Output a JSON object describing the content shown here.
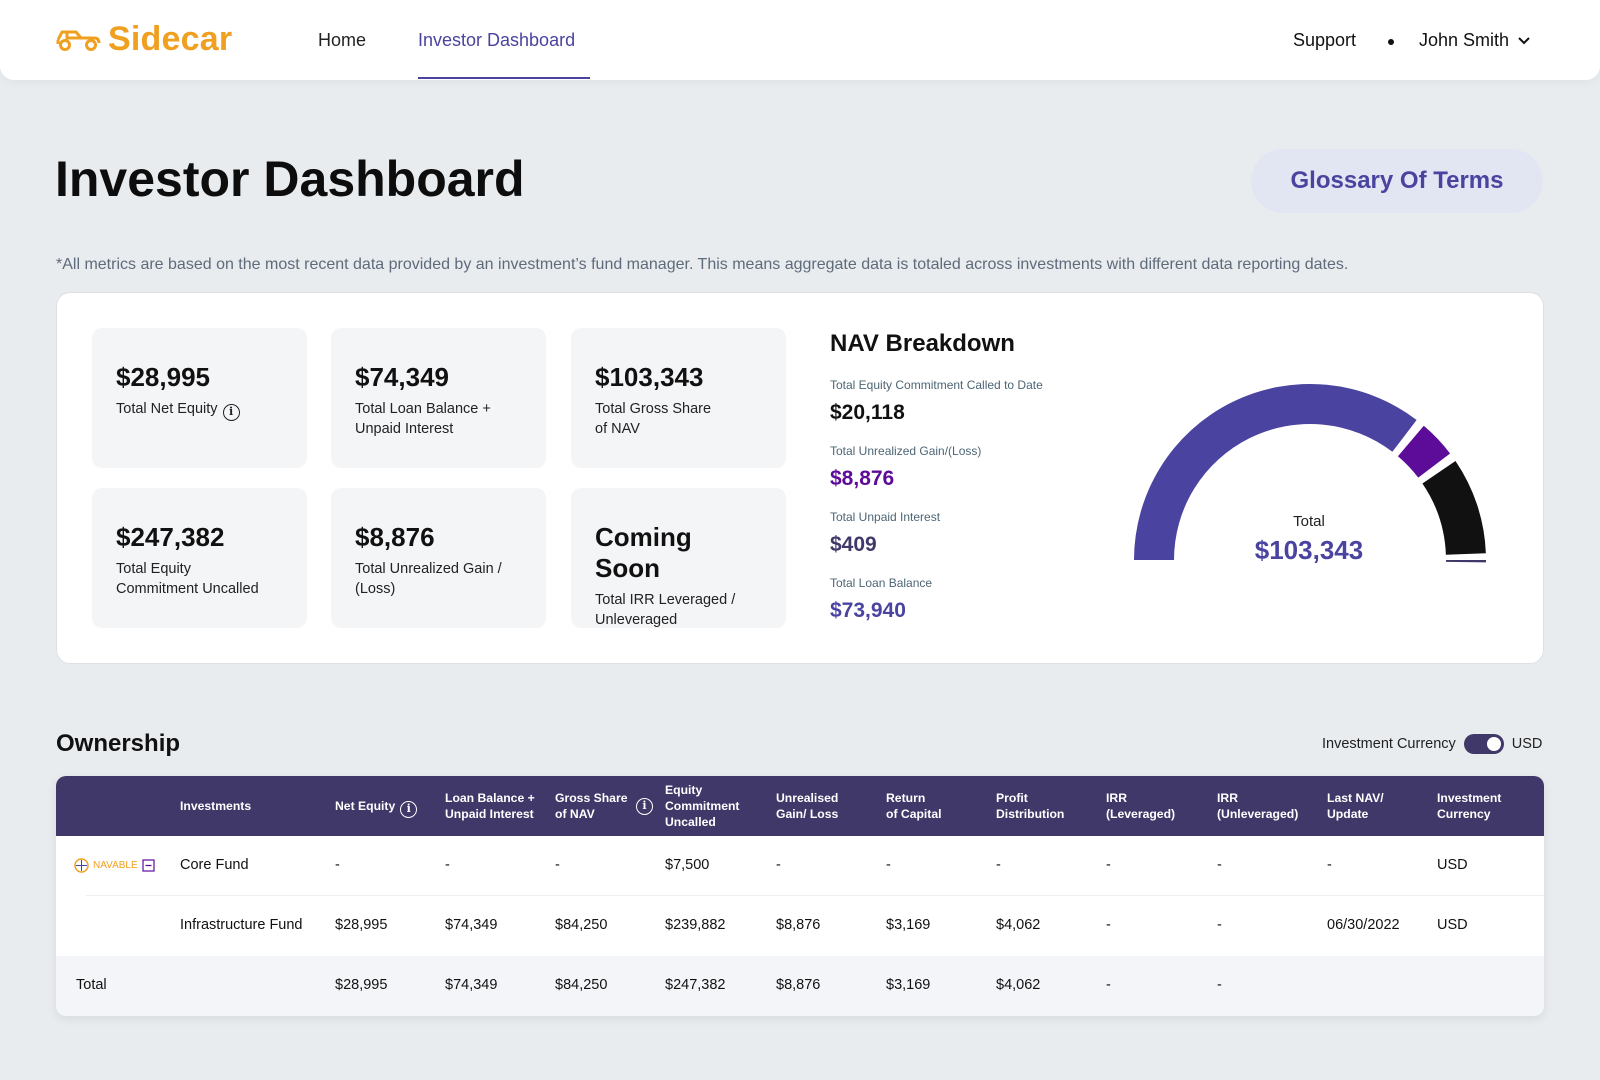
{
  "brand": {
    "name": "Sidecar",
    "icon": "car-icon",
    "color": "#f0a020"
  },
  "nav": {
    "home": "Home",
    "investor_dashboard": "Investor Dashboard",
    "support": "Support",
    "user": "John Smith"
  },
  "page": {
    "title": "Investor Dashboard",
    "glossary_button": "Glossary Of Terms",
    "disclaimer": "*All metrics are based on the most recent data provided by an investment’s fund manager. This means aggregate data is totaled across investments with different data reporting dates."
  },
  "metrics": [
    {
      "value": "$28,995",
      "label": "Total Net Equity"
    },
    {
      "value": "$74,349",
      "label_line1": "Total Loan Balance +",
      "label_line2": "Unpaid Interest"
    },
    {
      "value": "$103,343",
      "label_line1": "Total Gross Share",
      "label_line2": "of NAV"
    },
    {
      "value": "$247,382",
      "label_line1": "Total Equity",
      "label_line2": "Commitment Uncalled"
    },
    {
      "value": "$8,876",
      "label_line1": "Total Unrealized Gain /",
      "label_line2": "(Loss)"
    },
    {
      "value": "Coming Soon",
      "label_line1": "Total IRR Leveraged /",
      "label_line2": "Unleveraged"
    }
  ],
  "nav_breakdown": {
    "title": "NAV Breakdown",
    "items": [
      {
        "label": "Total Equity Commitment Called to Date",
        "value": "$20,118",
        "color": "#111111"
      },
      {
        "label": "Total Unrealized Gain/(Loss)",
        "value": "$8,876",
        "color": "#5d0c9a"
      },
      {
        "label": "Total Unpaid Interest",
        "value": "$409",
        "color": "#3f3868"
      },
      {
        "label": "Total Loan Balance",
        "value": "$73,940",
        "color": "#4a43a0"
      }
    ],
    "gauge": {
      "total_label": "Total",
      "total_value": "$103,343",
      "segments": [
        {
          "name": "Total Loan Balance",
          "value": 73940,
          "color": "#4a43a0"
        },
        {
          "name": "Total Unrealized Gain/(Loss)",
          "value": 8876,
          "color": "#5d0c9a"
        },
        {
          "name": "Total Equity Commitment Called to Date",
          "value": 20118,
          "color": "#111111"
        },
        {
          "name": "Total Unpaid Interest",
          "value": 409,
          "color": "#3f3868"
        }
      ]
    }
  },
  "ownership": {
    "title": "Ownership",
    "currency_toggle_label": "Investment Currency",
    "currency_value": "USD",
    "columns": [
      {
        "l1": "Investments",
        "l2": ""
      },
      {
        "l1": "Net Equity",
        "l2": "",
        "info": true
      },
      {
        "l1": "Loan Balance +",
        "l2": "Unpaid Interest"
      },
      {
        "l1": "Gross Share",
        "l2": "of NAV",
        "info": true
      },
      {
        "l1": "Equity",
        "l2": "Commitment",
        "l3": "Uncalled"
      },
      {
        "l1": "Unrealised",
        "l2": "Gain/ Loss"
      },
      {
        "l1": "Return",
        "l2": "of Capital"
      },
      {
        "l1": "Profit",
        "l2": "Distribution"
      },
      {
        "l1": "IRR",
        "l2": "(Leveraged)"
      },
      {
        "l1": "IRR",
        "l2": "(Unleveraged)"
      },
      {
        "l1": "Last NAV/",
        "l2": "Update"
      },
      {
        "l1": "Investment",
        "l2": "Currency"
      }
    ],
    "sponsor_logo": "NAVABLE",
    "rows": [
      [
        "Core Fund",
        "-",
        "-",
        "-",
        "$7,500",
        "-",
        "-",
        "-",
        "-",
        "-",
        "-",
        "USD"
      ],
      [
        "Infrastructure Fund",
        "$28,995",
        "$74,349",
        "$84,250",
        "$239,882",
        "$8,876",
        "$3,169",
        "$4,062",
        "-",
        "-",
        "06/30/2022",
        "USD"
      ]
    ],
    "total_row": [
      "Total",
      "$28,995",
      "$74,349",
      "$84,250",
      "$247,382",
      "$8,876",
      "$3,169",
      "$4,062",
      "-",
      "-",
      "",
      ""
    ]
  }
}
